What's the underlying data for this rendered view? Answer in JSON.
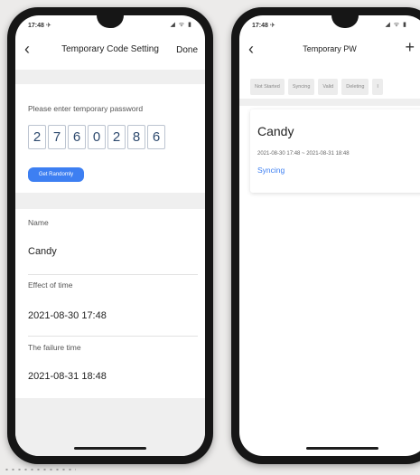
{
  "left_phone": {
    "status_time": "17:48 ✈",
    "status_icons": "◢ ᯤ ▮",
    "nav_title": "Temporary Code Setting",
    "done_label": "Done",
    "prompt": "Please enter temporary password",
    "code_digits": [
      "2",
      "7",
      "6",
      "0",
      "2",
      "8",
      "6"
    ],
    "random_button_label": "Get Randomly",
    "name_label": "Name",
    "name_value": "Candy",
    "effect_label": "Effect of time",
    "effect_value": "2021-08-30 17:48",
    "failure_label": "The failure time",
    "failure_value": "2021-08-31 18:48"
  },
  "right_phone": {
    "status_time": "17:48 ✈",
    "status_icons": "◢ ᯤ ▮",
    "nav_title": "Temporary PW",
    "tabs": [
      "Not Started",
      "Syncing",
      "Valid",
      "Deleting",
      "I"
    ],
    "card": {
      "name": "Candy",
      "range": "2021-08-30 17:48 ~ 2021-08-31 18:48",
      "status": "Syncing"
    }
  },
  "colors": {
    "accent": "#3d7ff2",
    "digit_text": "#2e4a6e",
    "frame": "#161616",
    "background": "#ecebea"
  }
}
